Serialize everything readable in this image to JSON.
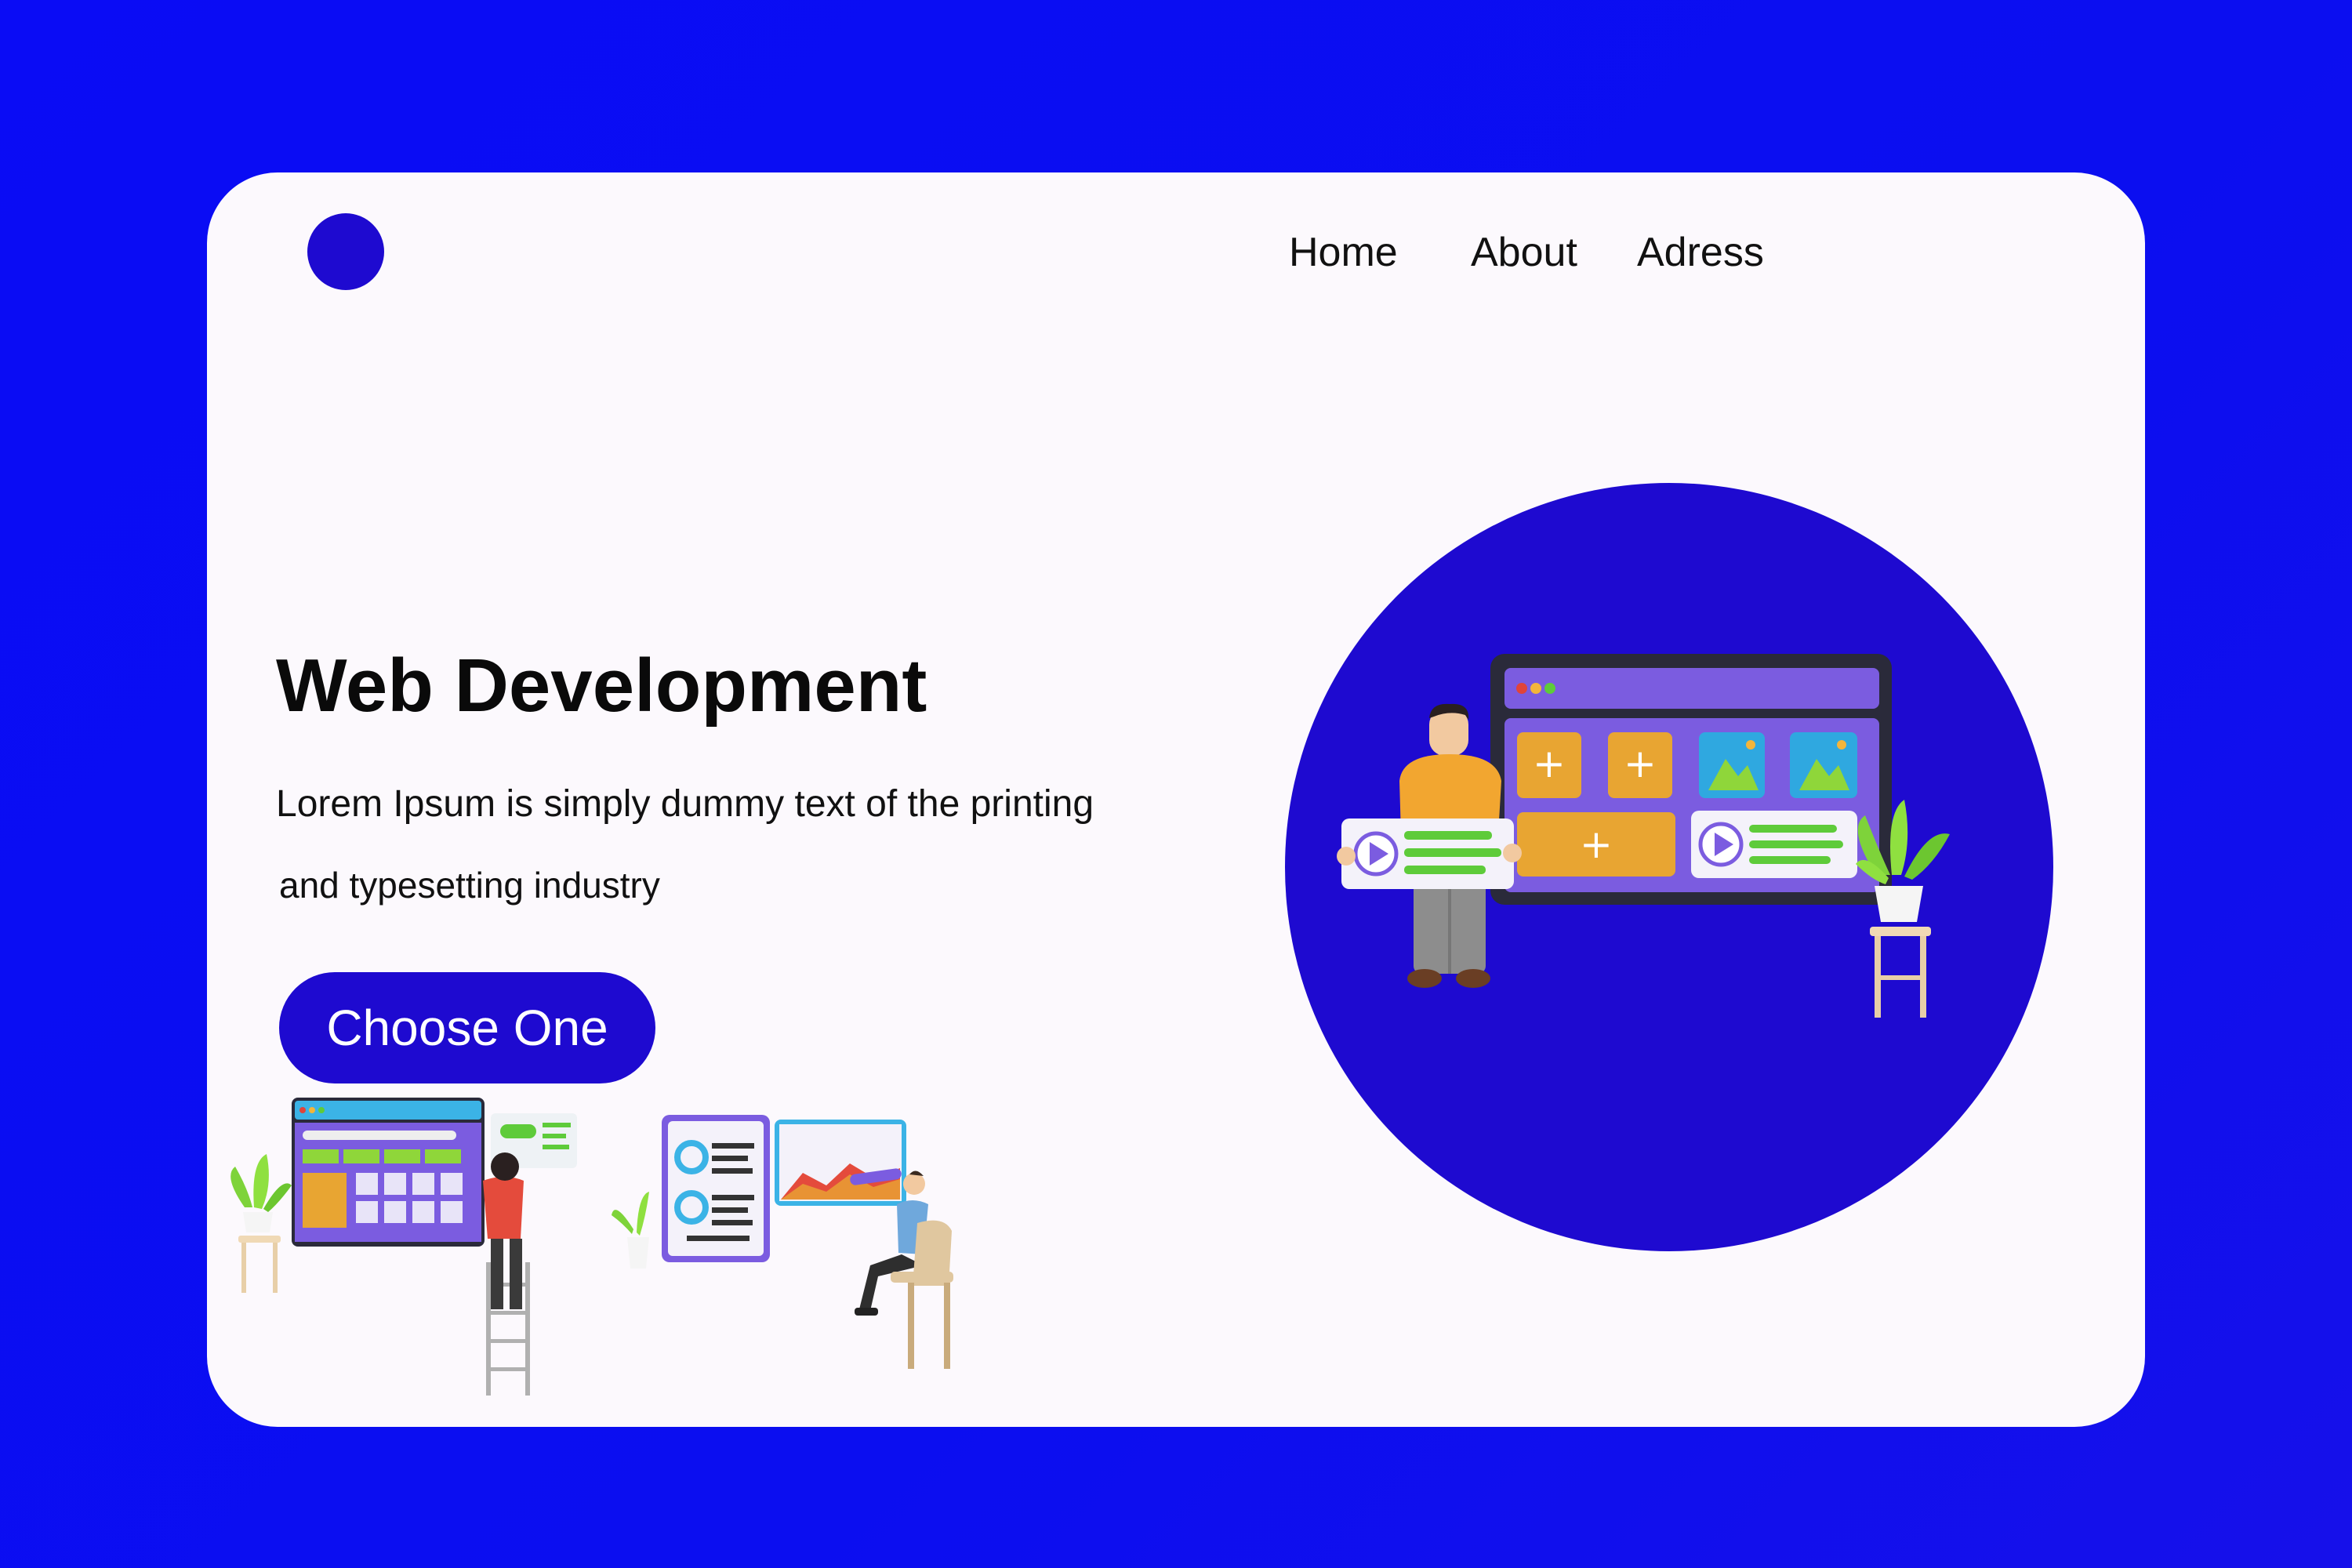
{
  "nav": {
    "home": "Home",
    "about": "About",
    "adress": "Adress"
  },
  "hero": {
    "title": "Web Development",
    "text_line1": "Lorem Ipsum is simply dummy text of the printing",
    "text_line2": "and typesetting industry",
    "cta_label": "Choose One"
  },
  "colors": {
    "page_background": "#0a0cf5",
    "card_background": "#fcf9fd",
    "accent": "#1e0ad0"
  },
  "icons": {
    "logo": "circle-logo-icon",
    "hero_illustration": "developer-with-dashboard-illustration",
    "bottom_illustration": "team-building-website-illustration"
  }
}
